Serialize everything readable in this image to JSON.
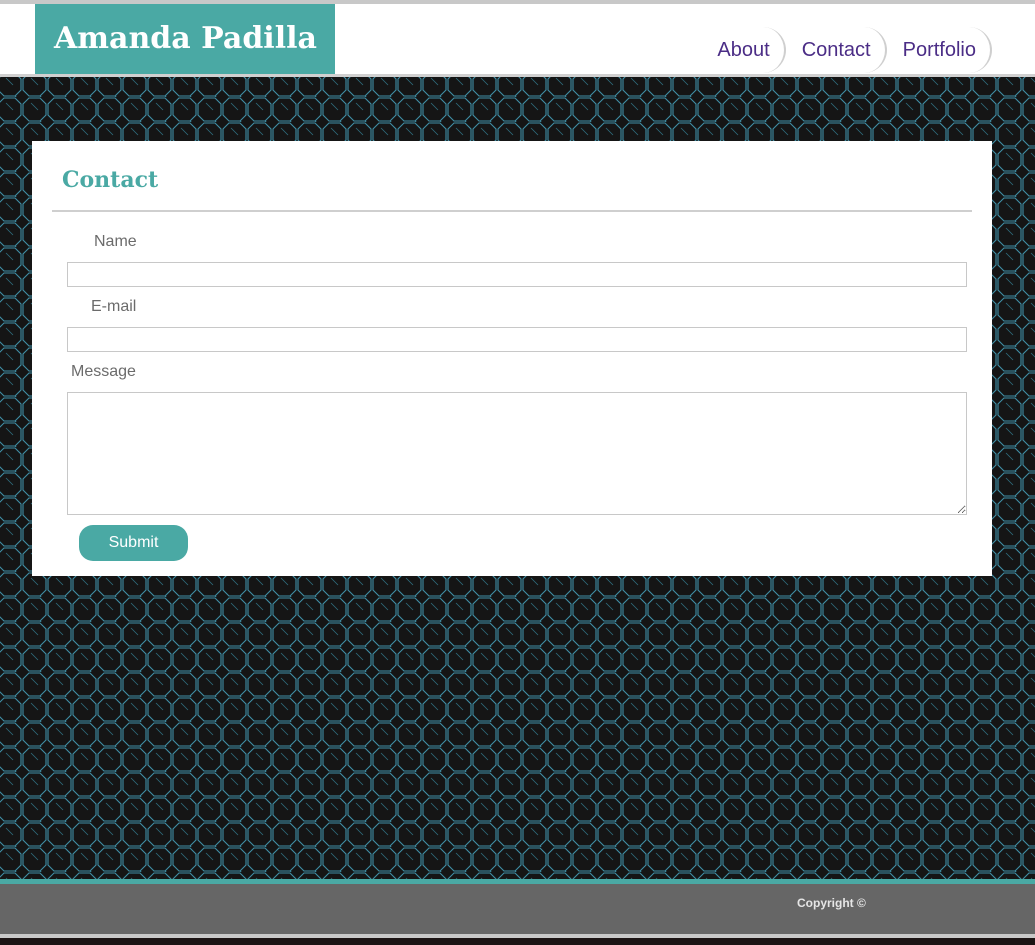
{
  "header": {
    "brand_name": "Amanda Padilla",
    "nav": [
      {
        "label": "About"
      },
      {
        "label": "Contact"
      },
      {
        "label": "Portfolio"
      }
    ]
  },
  "contact_form": {
    "title": "Contact",
    "name_label": "Name",
    "name_value": "",
    "email_label": "E-mail",
    "email_value": "",
    "message_label": "Message",
    "message_value": "",
    "submit_label": "Submit"
  },
  "footer": {
    "copyright": "Copyright ©"
  },
  "colors": {
    "accent": "#4aa9a4",
    "nav_text": "#4b2d86",
    "pattern_bg": "#151515",
    "pattern_line": "#3f8fa6",
    "footer_bg": "#666666"
  }
}
